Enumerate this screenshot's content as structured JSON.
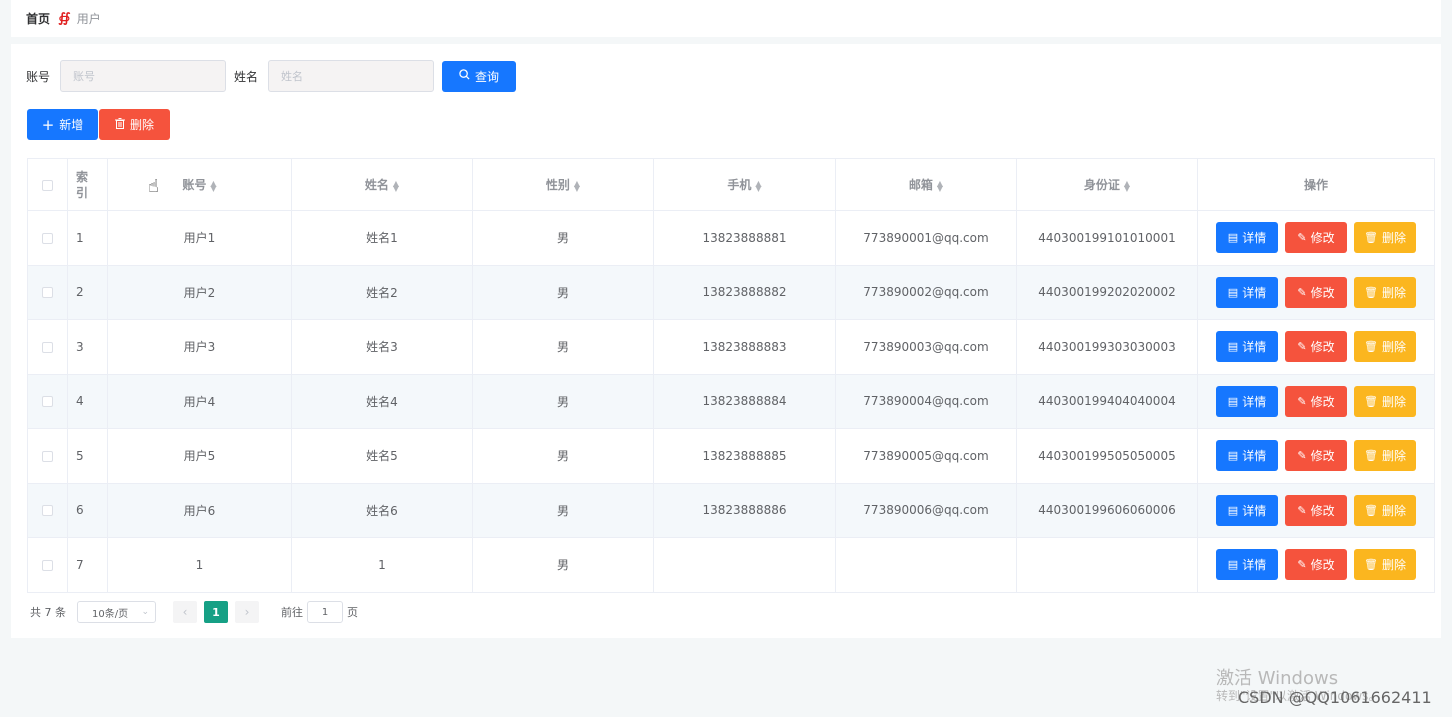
{
  "breadcrumb": {
    "home": "首页",
    "separator": "∯",
    "current": "用户"
  },
  "search": {
    "account_label": "账号",
    "account_placeholder": "账号",
    "name_label": "姓名",
    "name_placeholder": "姓名",
    "query_label": "查询"
  },
  "actions": {
    "add_label": "新增",
    "delete_label": "删除"
  },
  "table": {
    "headers": {
      "index": "索引",
      "account": "账号",
      "name": "姓名",
      "gender": "性别",
      "phone": "手机",
      "email": "邮箱",
      "idcard": "身份证",
      "ops": "操作"
    },
    "ops": {
      "detail": "详情",
      "edit": "修改",
      "remove": "删除"
    },
    "rows": [
      {
        "index": "1",
        "account": "用户1",
        "name": "姓名1",
        "gender": "男",
        "phone": "13823888881",
        "email": "773890001@qq.com",
        "idcard": "440300199101010001"
      },
      {
        "index": "2",
        "account": "用户2",
        "name": "姓名2",
        "gender": "男",
        "phone": "13823888882",
        "email": "773890002@qq.com",
        "idcard": "440300199202020002"
      },
      {
        "index": "3",
        "account": "用户3",
        "name": "姓名3",
        "gender": "男",
        "phone": "13823888883",
        "email": "773890003@qq.com",
        "idcard": "440300199303030003"
      },
      {
        "index": "4",
        "account": "用户4",
        "name": "姓名4",
        "gender": "男",
        "phone": "13823888884",
        "email": "773890004@qq.com",
        "idcard": "440300199404040004"
      },
      {
        "index": "5",
        "account": "用户5",
        "name": "姓名5",
        "gender": "男",
        "phone": "13823888885",
        "email": "773890005@qq.com",
        "idcard": "440300199505050005"
      },
      {
        "index": "6",
        "account": "用户6",
        "name": "姓名6",
        "gender": "男",
        "phone": "13823888886",
        "email": "773890006@qq.com",
        "idcard": "440300199606060006"
      },
      {
        "index": "7",
        "account": "1",
        "name": "1",
        "gender": "男",
        "phone": "",
        "email": "",
        "idcard": ""
      }
    ]
  },
  "pagination": {
    "total": "共 7 条",
    "page_size": "10条/页",
    "current_page": "1",
    "goto_label": "前往",
    "goto_value": "1",
    "page_suffix": "页"
  },
  "watermark": {
    "line1": "激活 Windows",
    "line2": "转到\"设置\"以激活 Windows。"
  },
  "credit": "CSDN @QQ1061662411",
  "colors": {
    "primary": "#1677ff",
    "danger": "#f5533d",
    "warning": "#fbb61f",
    "pager_active": "#16a085"
  }
}
